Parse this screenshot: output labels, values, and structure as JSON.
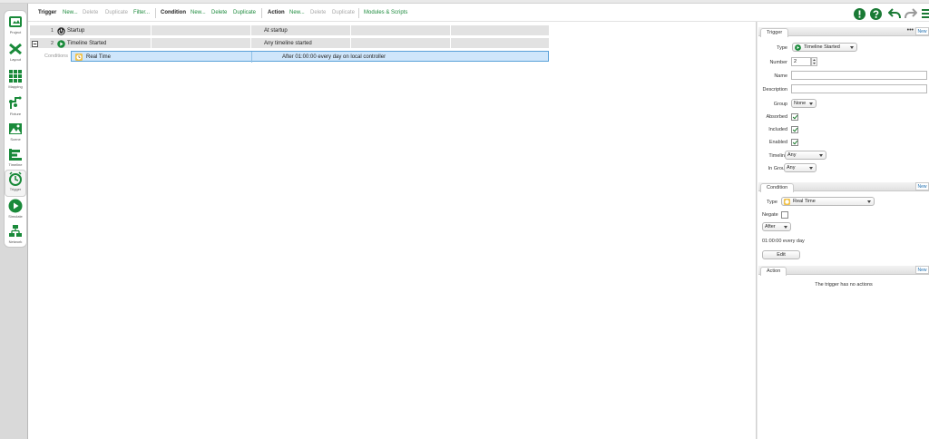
{
  "sidebar": {
    "items": [
      {
        "label": "Project",
        "icon": "project-icon"
      },
      {
        "label": "Layout",
        "icon": "layout-icon"
      },
      {
        "label": "Mapping",
        "icon": "mapping-icon"
      },
      {
        "label": "Fixture",
        "icon": "fixture-icon"
      },
      {
        "label": "Scene",
        "icon": "scene-icon"
      },
      {
        "label": "Timeline",
        "icon": "timeline-icon"
      },
      {
        "label": "Trigger",
        "icon": "trigger-icon"
      },
      {
        "label": "Simulate",
        "icon": "simulate-icon"
      },
      {
        "label": "Network",
        "icon": "network-icon"
      }
    ]
  },
  "toolbar": {
    "trigger": {
      "label": "Trigger",
      "new": "New...",
      "delete": "Delete",
      "duplicate": "Duplicate",
      "filter": "Filter..."
    },
    "condition": {
      "label": "Condition",
      "new": "New...",
      "delete": "Delete",
      "duplicate": "Duplicate"
    },
    "action": {
      "label": "Action",
      "new": "New...",
      "delete": "Delete",
      "duplicate": "Duplicate"
    },
    "modules": "Modules & Scripts"
  },
  "triggers": [
    {
      "number": "1",
      "name": "Startup",
      "description": "At startup"
    },
    {
      "number": "2",
      "name": "Timeline Started",
      "description": "Any timeline started"
    }
  ],
  "condition_row": {
    "label": "Conditions",
    "name": "Real Time",
    "summary": "After 01:00:00 every day on local controller"
  },
  "trigger_panel": {
    "tab": "Trigger",
    "new": "New",
    "type_label": "Type",
    "type_value": "Timeline Started",
    "number_label": "Number",
    "number_value": "2",
    "name_label": "Name",
    "description_label": "Description",
    "group_label": "Group",
    "group_value": "None",
    "absorbed_label": "Absorbed",
    "included_label": "Included",
    "enabled_label": "Enabled",
    "timeline_label": "Timeline",
    "timeline_value": "Any",
    "in_group_label": "In Group",
    "in_group_value": "Any"
  },
  "condition_panel": {
    "tab": "Condition",
    "new": "New",
    "type_label": "Type",
    "type_value": "Real Time",
    "negate_label": "Negate",
    "when_value": "After",
    "time_text": "01:00:00 every day",
    "edit_label": "Edit"
  },
  "action_panel": {
    "tab": "Action",
    "new": "New",
    "empty_text": "The trigger has no actions"
  },
  "colors": {
    "accent_green": "#1c8a3c",
    "selection": "#cfe6fb",
    "selection_border": "#5aa1d8"
  }
}
